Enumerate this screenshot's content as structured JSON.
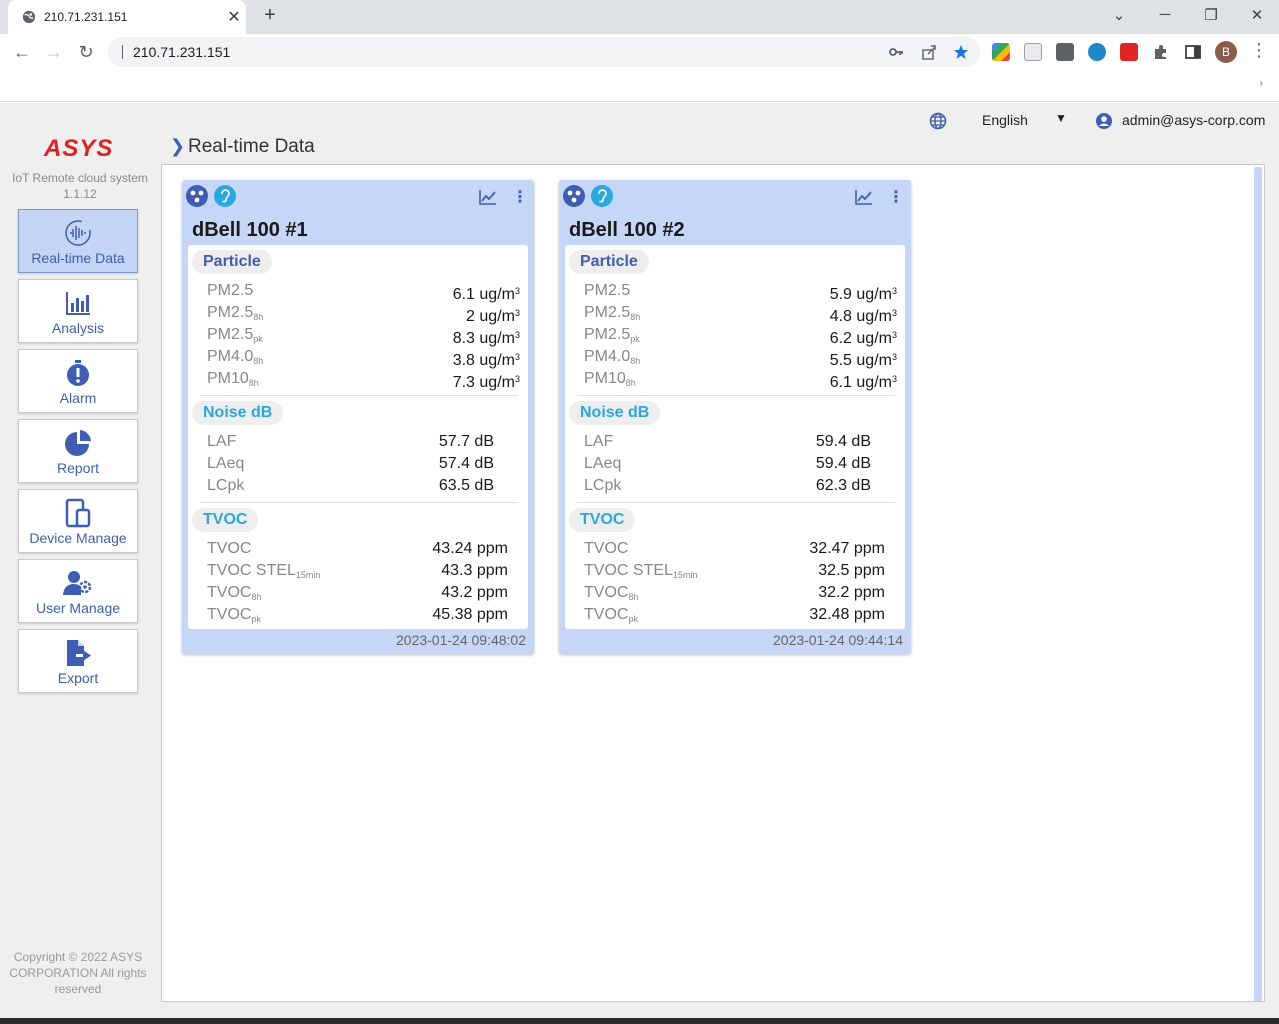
{
  "browser": {
    "tab_title": "210.71.231.151",
    "tab_close": "✕",
    "new_tab": "+",
    "url": "210.71.231.151",
    "profile_initial": "B"
  },
  "sidebar": {
    "logo": "ASYS",
    "system_name": "IoT Remote cloud system",
    "version": "1.1.12",
    "items": [
      {
        "label": "Real-time Data",
        "icon": "realtime-waveform-icon",
        "active": true
      },
      {
        "label": "Analysis",
        "icon": "bar-chart-icon"
      },
      {
        "label": "Alarm",
        "icon": "alarm-timer-icon"
      },
      {
        "label": "Report",
        "icon": "pie-chart-icon"
      },
      {
        "label": "Device Manage",
        "icon": "device-tablet-icon"
      },
      {
        "label": "User Manage",
        "icon": "user-gear-icon"
      },
      {
        "label": "Export",
        "icon": "file-export-icon"
      }
    ],
    "copyright": "Copyright © 2022 ASYS CORPORATION All rights reserved"
  },
  "header": {
    "language": "English",
    "user": "admin@asys-corp.com"
  },
  "breadcrumb": "Real-time Data",
  "colors": {
    "accent": "#3f5db4",
    "card_bg": "#c6d6f7",
    "cyan": "#2ba8e0",
    "logo_red": "#e32020"
  },
  "devices": [
    {
      "name": "dBell 100 #1",
      "particle_label": "Particle",
      "particle": [
        {
          "name": "PM2.5",
          "sub": "",
          "value": "6.1",
          "unit": "ug/m",
          "sup": "3"
        },
        {
          "name": "PM2.5",
          "sub": "8h",
          "value": "2",
          "unit": "ug/m",
          "sup": "3"
        },
        {
          "name": "PM2.5",
          "sub": "pk",
          "value": "8.3",
          "unit": "ug/m",
          "sup": "3"
        },
        {
          "name": "PM4.0",
          "sub": "8h",
          "value": "3.8",
          "unit": "ug/m",
          "sup": "3"
        },
        {
          "name": "PM10",
          "sub": "8h",
          "value": "7.3",
          "unit": "ug/m",
          "sup": "3"
        }
      ],
      "noise_label": "Noise dB",
      "noise": [
        {
          "name": "LAF",
          "value": "57.7 dB"
        },
        {
          "name": "LAeq",
          "value": "57.4 dB"
        },
        {
          "name": "LCpk",
          "value": "63.5 dB"
        }
      ],
      "tvoc_label": "TVOC",
      "tvoc": [
        {
          "name": "TVOC",
          "sub": "",
          "value": "43.24 ppm"
        },
        {
          "name": "TVOC STEL",
          "sub": "15min",
          "value": "43.3 ppm"
        },
        {
          "name": "TVOC",
          "sub": "8h",
          "value": "43.2 ppm"
        },
        {
          "name": "TVOC",
          "sub": "pk",
          "value": "45.38 ppm"
        }
      ],
      "timestamp": "2023-01-24 09:48:02"
    },
    {
      "name": "dBell 100 #2",
      "particle_label": "Particle",
      "particle": [
        {
          "name": "PM2.5",
          "sub": "",
          "value": "5.9",
          "unit": "ug/m",
          "sup": "3"
        },
        {
          "name": "PM2.5",
          "sub": "8h",
          "value": "4.8",
          "unit": "ug/m",
          "sup": "3"
        },
        {
          "name": "PM2.5",
          "sub": "pk",
          "value": "6.2",
          "unit": "ug/m",
          "sup": "3"
        },
        {
          "name": "PM4.0",
          "sub": "8h",
          "value": "5.5",
          "unit": "ug/m",
          "sup": "3"
        },
        {
          "name": "PM10",
          "sub": "8h",
          "value": "6.1",
          "unit": "ug/m",
          "sup": "3"
        }
      ],
      "noise_label": "Noise dB",
      "noise": [
        {
          "name": "LAF",
          "value": "59.4 dB"
        },
        {
          "name": "LAeq",
          "value": "59.4 dB"
        },
        {
          "name": "LCpk",
          "value": "62.3 dB"
        }
      ],
      "tvoc_label": "TVOC",
      "tvoc": [
        {
          "name": "TVOC",
          "sub": "",
          "value": "32.47 ppm"
        },
        {
          "name": "TVOC STEL",
          "sub": "15min",
          "value": "32.5 ppm"
        },
        {
          "name": "TVOC",
          "sub": "8h",
          "value": "32.2 ppm"
        },
        {
          "name": "TVOC",
          "sub": "pk",
          "value": "32.48 ppm"
        }
      ],
      "timestamp": "2023-01-24 09:44:14"
    }
  ]
}
